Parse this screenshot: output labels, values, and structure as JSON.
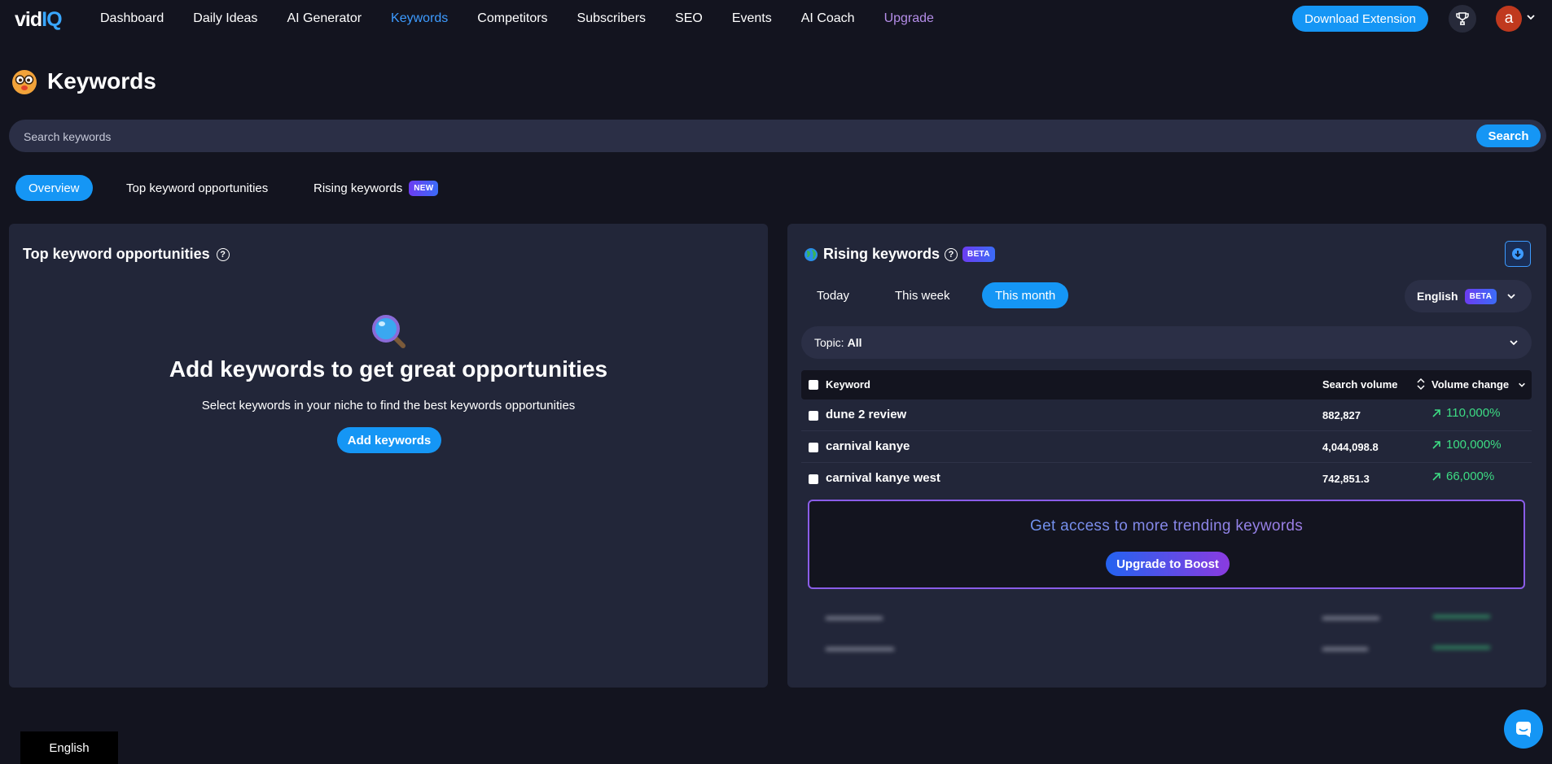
{
  "nav": {
    "logo_main": "vid",
    "logo_accent": "IQ",
    "links": [
      "Dashboard",
      "Daily Ideas",
      "AI Generator",
      "Keywords",
      "Competitors",
      "Subscribers",
      "SEO",
      "Events",
      "AI Coach",
      "Upgrade"
    ],
    "download_label": "Download Extension",
    "avatar_letter": "a"
  },
  "page": {
    "title": "Keywords"
  },
  "search": {
    "placeholder": "Search keywords",
    "button_label": "Search"
  },
  "tabs": {
    "overview": "Overview",
    "top": "Top keyword opportunities",
    "rising": "Rising keywords",
    "rising_badge": "NEW"
  },
  "left_panel": {
    "title": "Top keyword opportunities",
    "help": "?",
    "empty_title": "Add keywords to get great opportunities",
    "empty_subtitle": "Select keywords in your niche to find the best keywords opportunities",
    "add_button": "Add keywords"
  },
  "right_panel": {
    "title": "Rising keywords",
    "help": "?",
    "badge": "BETA",
    "periods": {
      "today": "Today",
      "week": "This week",
      "month": "This month"
    },
    "language": {
      "label": "English",
      "badge": "BETA"
    },
    "topic": {
      "label": "Topic:",
      "value": "All"
    },
    "table": {
      "headers": {
        "keyword": "Keyword",
        "volume": "Search volume",
        "change": "Volume change"
      },
      "rows": [
        {
          "keyword": "dune 2 review",
          "volume": "882,827",
          "change": "110,000%"
        },
        {
          "keyword": "carnival kanye",
          "volume": "4,044,098.8",
          "change": "100,000%"
        },
        {
          "keyword": "carnival kanye west",
          "volume": "742,851.3",
          "change": "66,000%"
        }
      ]
    },
    "cta": {
      "text": "Get access to more trending keywords",
      "button": "Upgrade to Boost"
    }
  },
  "footer": {
    "language": "English"
  },
  "colors": {
    "accent": "#1596f5",
    "background": "#13141f",
    "panel": "#222639",
    "positive": "#3ddc84",
    "upgrade": "#b48de8"
  }
}
